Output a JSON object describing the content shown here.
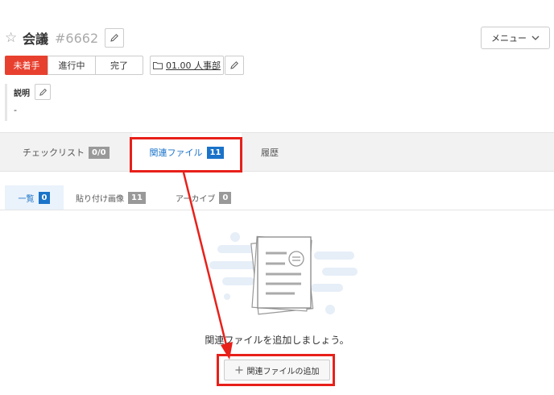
{
  "task": {
    "title": "会議",
    "id": "#6662"
  },
  "menu": {
    "label": "メニュー"
  },
  "status": {
    "options": [
      "未着手",
      "進行中",
      "完了"
    ],
    "selected": "未着手"
  },
  "category": {
    "label": "01.00 人事部"
  },
  "description": {
    "label": "説明",
    "value": "-"
  },
  "tabs": [
    {
      "label": "チェックリスト",
      "count": "0/0"
    },
    {
      "label": "関連ファイル",
      "count": "11"
    },
    {
      "label": "履歴"
    }
  ],
  "subtabs": [
    {
      "label": "一覧",
      "count": "0"
    },
    {
      "label": "貼り付け画像",
      "count": "11"
    },
    {
      "label": "アーカイブ",
      "count": "0"
    }
  ],
  "empty": {
    "message": "関連ファイルを追加しましょう。"
  },
  "add_button": {
    "label": "関連ファイルの追加"
  },
  "colors": {
    "status_active": "#e8402f",
    "accent": "#1a73c9",
    "annotation": "#e8201a"
  }
}
